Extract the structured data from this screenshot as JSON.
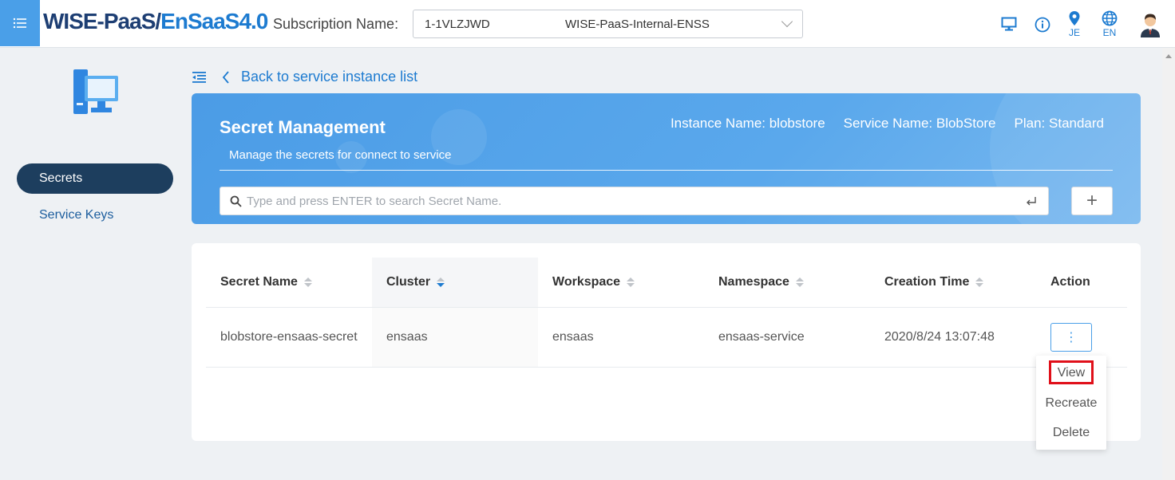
{
  "header": {
    "brand_part1": "WISE-PaaS/",
    "brand_part2": "EnSaaS4.0",
    "subscription_label": "Subscription Name:",
    "subscription_code": "1-1VLZJWD",
    "subscription_name": "WISE-PaaS-Internal-ENSS",
    "icons": [
      "menu-icon",
      "monitor-icon",
      "info-icon",
      "location-icon",
      "globe-icon",
      "user-avatar-icon"
    ],
    "location_label": "JE",
    "language_label": "EN"
  },
  "sidebar": {
    "items": [
      {
        "label": "Secrets",
        "active": true
      },
      {
        "label": "Service Keys",
        "active": false
      }
    ]
  },
  "back_link": "Back to service instance list",
  "hero": {
    "title": "Secret Management",
    "subtitle": "Manage the secrets for connect to service",
    "instance_name": "Instance Name: blobstore",
    "service_name": "Service Name: BlobStore",
    "plan": "Plan: Standard",
    "search_placeholder": "Type and press ENTER to search Secret Name.",
    "add_label": "+"
  },
  "table": {
    "headers": [
      "Secret Name",
      "Cluster",
      "Workspace",
      "Namespace",
      "Creation Time",
      "Action"
    ],
    "rows": [
      {
        "secret_name": "blobstore-ensaas-secret",
        "cluster": "ensaas",
        "workspace": "ensaas",
        "namespace": "ensaas-service",
        "creation_time": "2020/8/24 13:07:48"
      }
    ],
    "action_button": "⋮"
  },
  "dropdown": {
    "items": [
      "View",
      "Recreate",
      "Delete"
    ]
  },
  "colors": {
    "accent": "#4a9fe8",
    "brand_dark": "#1d3e73",
    "brand_blue": "#1d7bd0",
    "sidebar_active": "#1d3e5e",
    "highlight_border": "#e0101a"
  }
}
